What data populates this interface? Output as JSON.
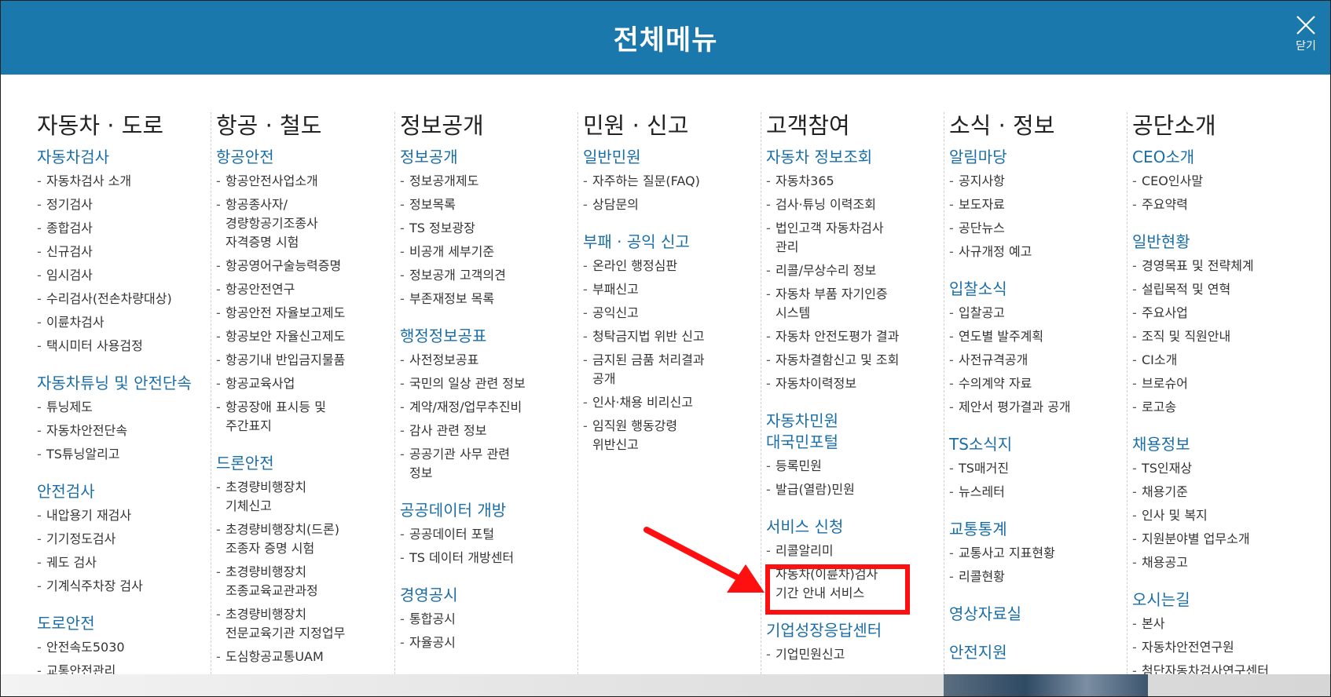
{
  "header": {
    "title": "전체메뉴",
    "close_label": "닫기"
  },
  "columns": [
    {
      "title": "자동차 · 도로",
      "sections": [
        {
          "title": "자동차검사",
          "items": [
            "자동차검사 소개",
            "정기검사",
            "종합검사",
            "신규검사",
            "임시검사",
            "수리검사(전손차량대상)",
            "이륜차검사",
            "택시미터 사용검정"
          ]
        },
        {
          "title": "자동차튜닝 및 안전단속",
          "items": [
            "튜닝제도",
            "자동차안전단속",
            "TS튜닝알리고"
          ]
        },
        {
          "title": "안전검사",
          "items": [
            "내압용기 재검사",
            "기기정도검사",
            "궤도 검사",
            "기계식주차장 검사"
          ]
        },
        {
          "title": "도로안전",
          "items": [
            "안전속도5030",
            "교통안전관리"
          ]
        }
      ]
    },
    {
      "title": "항공 · 철도",
      "sections": [
        {
          "title": "항공안전",
          "items": [
            "항공안전사업소개",
            "항공종사자/\n경량항공기조종사\n자격증명 시험",
            "항공영어구술능력증명",
            "항공안전연구",
            "항공안전 자율보고제도",
            "항공보안 자율신고제도",
            "항공기내 반입금지물품",
            "항공교육사업",
            "항공장애 표시등 및\n주간표지"
          ]
        },
        {
          "title": "드론안전",
          "items": [
            "초경량비행장치\n기체신고",
            "초경량비행장치(드론)\n조종자 증명 시험",
            "초경량비행장치\n조종교육교관과정",
            "초경량비행장치\n전문교육기관 지정업무",
            "도심항공교통UAM"
          ]
        }
      ]
    },
    {
      "title": "정보공개",
      "sections": [
        {
          "title": "정보공개",
          "items": [
            "정보공개제도",
            "정보목록",
            "TS 정보광장",
            "비공개 세부기준",
            "정보공개 고객의견",
            "부존재정보 목록"
          ]
        },
        {
          "title": "행정정보공표",
          "items": [
            "사전정보공표",
            "국민의 일상 관련 정보",
            "계약/재정/업무추진비",
            "감사 관련 정보",
            "공공기관 사무 관련\n정보"
          ]
        },
        {
          "title": "공공데이터 개방",
          "items": [
            "공공데이터 포털",
            "TS 데이터 개방센터"
          ]
        },
        {
          "title": "경영공시",
          "items": [
            "통합공시",
            "자율공시"
          ]
        }
      ]
    },
    {
      "title": "민원 · 신고",
      "sections": [
        {
          "title": "일반민원",
          "items": [
            "자주하는 질문(FAQ)",
            "상담문의"
          ]
        },
        {
          "title": "부패 · 공익 신고",
          "items": [
            "온라인 행정심판",
            "부패신고",
            "공익신고",
            "청탁금지법 위반 신고",
            "금지된 금품 처리결과\n공개",
            "인사·채용 비리신고",
            "임직원 행동강령\n위반신고"
          ]
        }
      ]
    },
    {
      "title": "고객참여",
      "sections": [
        {
          "title": "자동차 정보조회",
          "items": [
            "자동차365",
            "검사·튜닝 이력조회",
            "법인고객 자동차검사\n관리",
            "리콜/무상수리 정보",
            "자동차 부품 자기인증\n시스템",
            "자동차 안전도평가 결과",
            "자동차결함신고 및 조회",
            "자동차이력정보"
          ]
        },
        {
          "title": "자동차민원\n대국민포털",
          "items": [
            "등록민원",
            "발급(열람)민원"
          ]
        },
        {
          "title": "서비스 신청",
          "items": [
            "리콜알리미",
            "자동차(이륜차)검사\n기간 안내 서비스"
          ]
        },
        {
          "title": "기업성장응답센터",
          "items": [
            "기업민원신고"
          ]
        }
      ]
    },
    {
      "title": "소식 · 정보",
      "sections": [
        {
          "title": "알림마당",
          "items": [
            "공지사항",
            "보도자료",
            "공단뉴스",
            "사규개정 예고"
          ]
        },
        {
          "title": "입찰소식",
          "items": [
            "입찰공고",
            "연도별 발주계획",
            "사전규격공개",
            "수의계약 자료",
            "제안서 평가결과 공개"
          ]
        },
        {
          "title": "TS소식지",
          "items": [
            "TS매거진",
            "뉴스레터"
          ]
        },
        {
          "title": "교통통계",
          "items": [
            "교통사고 지표현황",
            "리콜현황"
          ]
        },
        {
          "title": "영상자료실",
          "items": []
        },
        {
          "title": "안전지원",
          "items": []
        }
      ]
    },
    {
      "title": "공단소개",
      "sections": [
        {
          "title": "CEO소개",
          "items": [
            "CEO인사말",
            "주요약력"
          ]
        },
        {
          "title": "일반현황",
          "items": [
            "경영목표 및 전략체계",
            "설립목적 및 연혁",
            "주요사업",
            "조직 및 직원안내",
            "CI소개",
            "브로슈어",
            "로고송"
          ]
        },
        {
          "title": "채용정보",
          "items": [
            "TS인재상",
            "채용기준",
            "인사 및 복지",
            "지원분야별 업무소개",
            "채용공고"
          ]
        },
        {
          "title": "오시는길",
          "items": [
            "본사",
            "자동차안전연구원",
            "첨단자동차검사연구센터"
          ]
        }
      ]
    }
  ],
  "colors": {
    "header_bg": "#1a78ad",
    "section_title": "#1a6ea8",
    "highlight": "#ff1010"
  }
}
